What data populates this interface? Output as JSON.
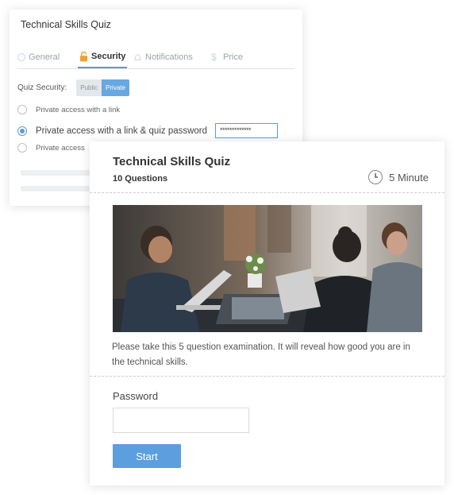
{
  "settings": {
    "title": "Technical Skills Quiz",
    "tabs": [
      {
        "label": "General",
        "icon": "circle-icon"
      },
      {
        "label": "Security",
        "icon": "lock-icon"
      },
      {
        "label": "Notifications",
        "icon": "bell-icon"
      },
      {
        "label": "Price",
        "icon": "dollar-icon"
      }
    ],
    "active_tab": "Security",
    "security_label": "Quiz Security:",
    "toggle": {
      "off": "Public",
      "on": "Private"
    },
    "options": [
      {
        "label": "Private access with a link",
        "checked": false
      },
      {
        "label": "Private access with a link & quiz password",
        "checked": true
      },
      {
        "label": "Private access",
        "checked": false
      }
    ],
    "password_value": "*************"
  },
  "quiz": {
    "title": "Technical Skills Quiz",
    "question_count": "10 Questions",
    "duration": "5 Minute",
    "description": "Please take this 5 question examination. It will reveal how good you are in the technical skills.",
    "password_label": "Password",
    "password_value": "",
    "start_label": "Start"
  },
  "colors": {
    "accent": "#5b9fde",
    "toggle_on": "#67a8e0",
    "lock": "#f0a030"
  }
}
